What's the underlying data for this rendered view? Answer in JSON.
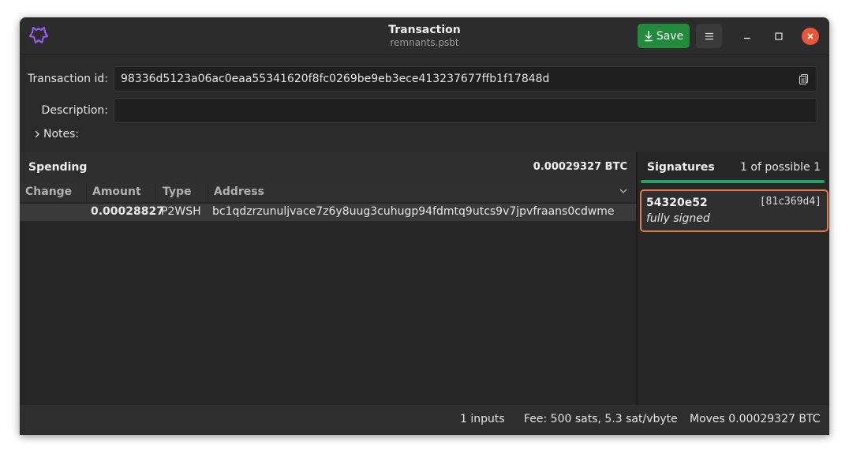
{
  "header": {
    "title": "Transaction",
    "subtitle": "remnants.psbt",
    "save_label": "Save",
    "icons": {
      "logo": "sparrow-logo-icon",
      "save": "download-icon",
      "menu": "hamburger-menu-icon",
      "minimize": "minimize-icon",
      "maximize": "maximize-icon",
      "close": "close-icon"
    }
  },
  "form": {
    "txid_label": "Transaction id:",
    "txid_value": "98336d5123a06ac0eaa55341620f8fc0269be9eb3ece413237677ffb1f17848d",
    "description_label": "Description:",
    "description_value": "",
    "notes_label": "Notes:"
  },
  "spending": {
    "title": "Spending",
    "total": "0.00029327 BTC",
    "columns": [
      "Change",
      "Amount",
      "Type",
      "Address"
    ],
    "rows": [
      {
        "change": "",
        "amount": "0.00028827",
        "type": "P2WSH",
        "address": "bc1qdzrzunuljvace7z6y8uug3cuhugp94fdmtq9utcs9v7jpvfraans0cdwme"
      }
    ]
  },
  "signatures": {
    "title": "Signatures",
    "count": "1 of possible 1",
    "progress": 1.0,
    "items": [
      {
        "id": "54320e52",
        "fingerprint": "[81c369d4]",
        "status": "fully signed"
      }
    ]
  },
  "status": {
    "inputs": "1  inputs",
    "fee": "Fee:  500 sats, 5.3 sat/vbyte",
    "moves": "Moves  0.00029327 BTC"
  },
  "colors": {
    "save": "#1f8b3b",
    "close": "#e9563a",
    "signature_border": "#e07b53",
    "progress": "#26a269",
    "logo": "#9b59f0"
  }
}
